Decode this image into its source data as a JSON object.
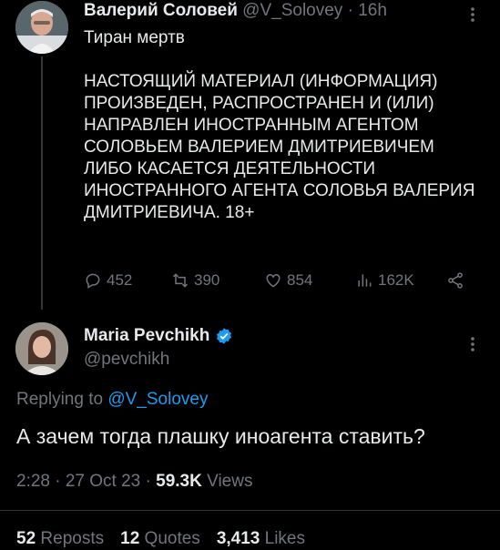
{
  "parent_tweet": {
    "author_name": "Валерий Соловей",
    "handle": "@V_Solovey",
    "separator": "·",
    "time": "16h",
    "text": "Тиран мертв\n\nНАСТОЯЩИЙ МАТЕРИАЛ (ИНФОРМАЦИЯ) ПРОИЗВЕДЕН, РАСПРОСТРАНЕН И (ИЛИ) НАПРАВЛЕН ИНОСТРАННЫМ АГЕНТОМ СОЛОВЬЕМ ВАЛЕРИЕМ ДМИТРИЕВИЧЕМ ЛИБО КАСАЕТСЯ ДЕЯТЕЛЬНОСТИ ИНОСТРАННОГО АГЕНТА  СОЛОВЬЯ ВАЛЕРИЯ ДМИТРИЕВИЧА.  18+",
    "counts": {
      "replies": "452",
      "reposts": "390",
      "likes": "854",
      "views": "162K"
    }
  },
  "reply_tweet": {
    "author_name": "Maria Pevchikh",
    "handle": "@pevchikh",
    "replying_prefix": "Replying to ",
    "replying_to": "@V_Solovey",
    "text": "А зачем тогда плашку иноагента ставить?",
    "time": "2:28 · 27 Oct 23 · ",
    "views_count": "59.3K",
    "views_label": " Views",
    "stats": {
      "reposts_count": "52",
      "reposts_label": " Reposts",
      "quotes_count": "12",
      "quotes_label": " Quotes",
      "likes_count": "3,413",
      "likes_label": " Likes"
    }
  },
  "colors": {
    "background": "#000000",
    "text": "#e7e9ea",
    "muted": "#71767b",
    "accent": "#1d9bf0"
  },
  "icons": [
    "more-icon",
    "reply-icon",
    "repost-icon",
    "like-icon",
    "views-icon",
    "share-icon",
    "verified-icon"
  ]
}
